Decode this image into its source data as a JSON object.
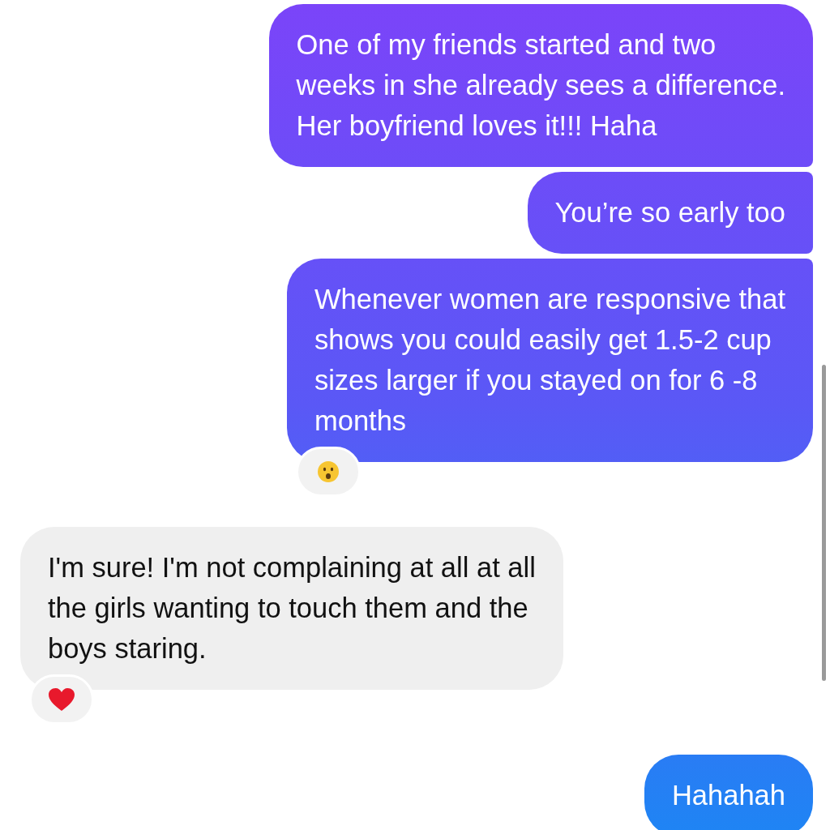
{
  "messages": [
    {
      "kind": "sent",
      "text": "One of my friends started and two\nweeks in she already sees a difference.\nHer boyfriend loves it!!! Haha"
    },
    {
      "kind": "sent",
      "text": "You’re so early too"
    },
    {
      "kind": "sent",
      "text": "Whenever women are responsive that\nshows you could easily get 1.5-2 cup\nsizes larger if you stayed on for 6 -8\nmonths",
      "reaction": {
        "kind": "surprised"
      }
    },
    {
      "kind": "received",
      "text": "I'm sure! I'm not complaining at all at all\nthe girls wanting to touch them and the\nboys staring.",
      "reaction": {
        "kind": "heart"
      }
    },
    {
      "kind": "sent",
      "text": "Hahahah"
    }
  ]
}
